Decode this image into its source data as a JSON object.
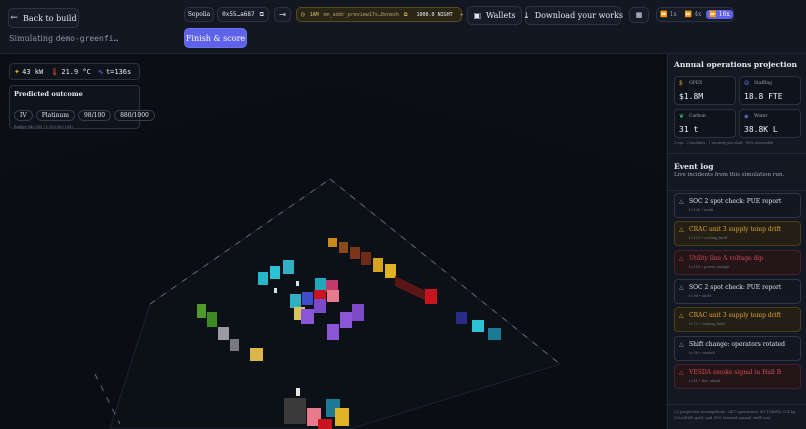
{
  "header": {
    "back_label": "Back to build",
    "simulating_prefix": "Simulating",
    "simulating_name": "demo-greenfi…",
    "network": "Sepolia",
    "address": "0x55…a687",
    "wallet_badge": "1AM",
    "wallet_id": "mn_addr_preview17s…8xnesh",
    "balance": "1000.0 NIGHT",
    "wallets_label": "Wallets",
    "download_label": "Download your works",
    "finish_label": "Finish & score",
    "speeds": [
      "1x",
      "4x",
      "16x"
    ],
    "active_speed": "16x"
  },
  "hud": {
    "power": "43 kW",
    "temp": "21.9 °C",
    "time": "t=136s",
    "outcome_title": "Predicted outcome",
    "tags": [
      "IV",
      "Platinum",
      "98/100",
      "880/1000"
    ],
    "budget": "Budget 840,500 / 1,920,000 USD"
  },
  "projection": {
    "title": "Annual operations projection",
    "metrics": [
      {
        "label": "OPEX",
        "value": "$1.8M",
        "icon": "dollar-icon",
        "color": "#e3a52c"
      },
      {
        "label": "Staffing",
        "value": "18.8 FTE",
        "icon": "people-icon",
        "color": "#6f7cf2"
      },
      {
        "label": "Carbon",
        "value": "31 t",
        "icon": "leaf-icon",
        "color": "#3fbf6a"
      },
      {
        "label": "Water",
        "value": "38.8K L",
        "icon": "droplet-icon",
        "color": "#6f7cf2"
      }
    ],
    "note": "1 ops · 2 facilities · 1 security per shift · 90% renewable"
  },
  "events": {
    "title": "Event log",
    "subtitle": "Live incidents from this simulation run.",
    "items": [
      {
        "title": "SOC 2 spot check: PUE report",
        "sub": "t=136 • audit",
        "kind": "info"
      },
      {
        "title": "CRAC unit 3 supply temp drift",
        "sub": "t=129 • cooling_fault",
        "kind": "warn"
      },
      {
        "title": "Utility line A voltage dip",
        "sub": "t=118 • power_outage",
        "kind": "crit"
      },
      {
        "title": "SOC 2 spot check: PUE report",
        "sub": "t=96 • audit",
        "kind": "info"
      },
      {
        "title": "CRAC unit 3 supply temp drift",
        "sub": "t=72 • cooling_fault",
        "kind": "warn"
      },
      {
        "title": "Shift change: operators rotated",
        "sub": "t=58 • control",
        "kind": "info"
      },
      {
        "title": "VESDA smoke signal in Hall B",
        "sub": "t=41 • fire_alarm",
        "kind": "crit"
      }
    ],
    "footer": "L2 projection assumptions: 24/7 operations, $0.12/kWh, 0.4 kg CO₂e/kWh grid, and 99% trusted annual staff cost."
  },
  "colors": {
    "accent": "#5d62e8",
    "warning": "#e3a52c",
    "critical": "#d9494f"
  }
}
